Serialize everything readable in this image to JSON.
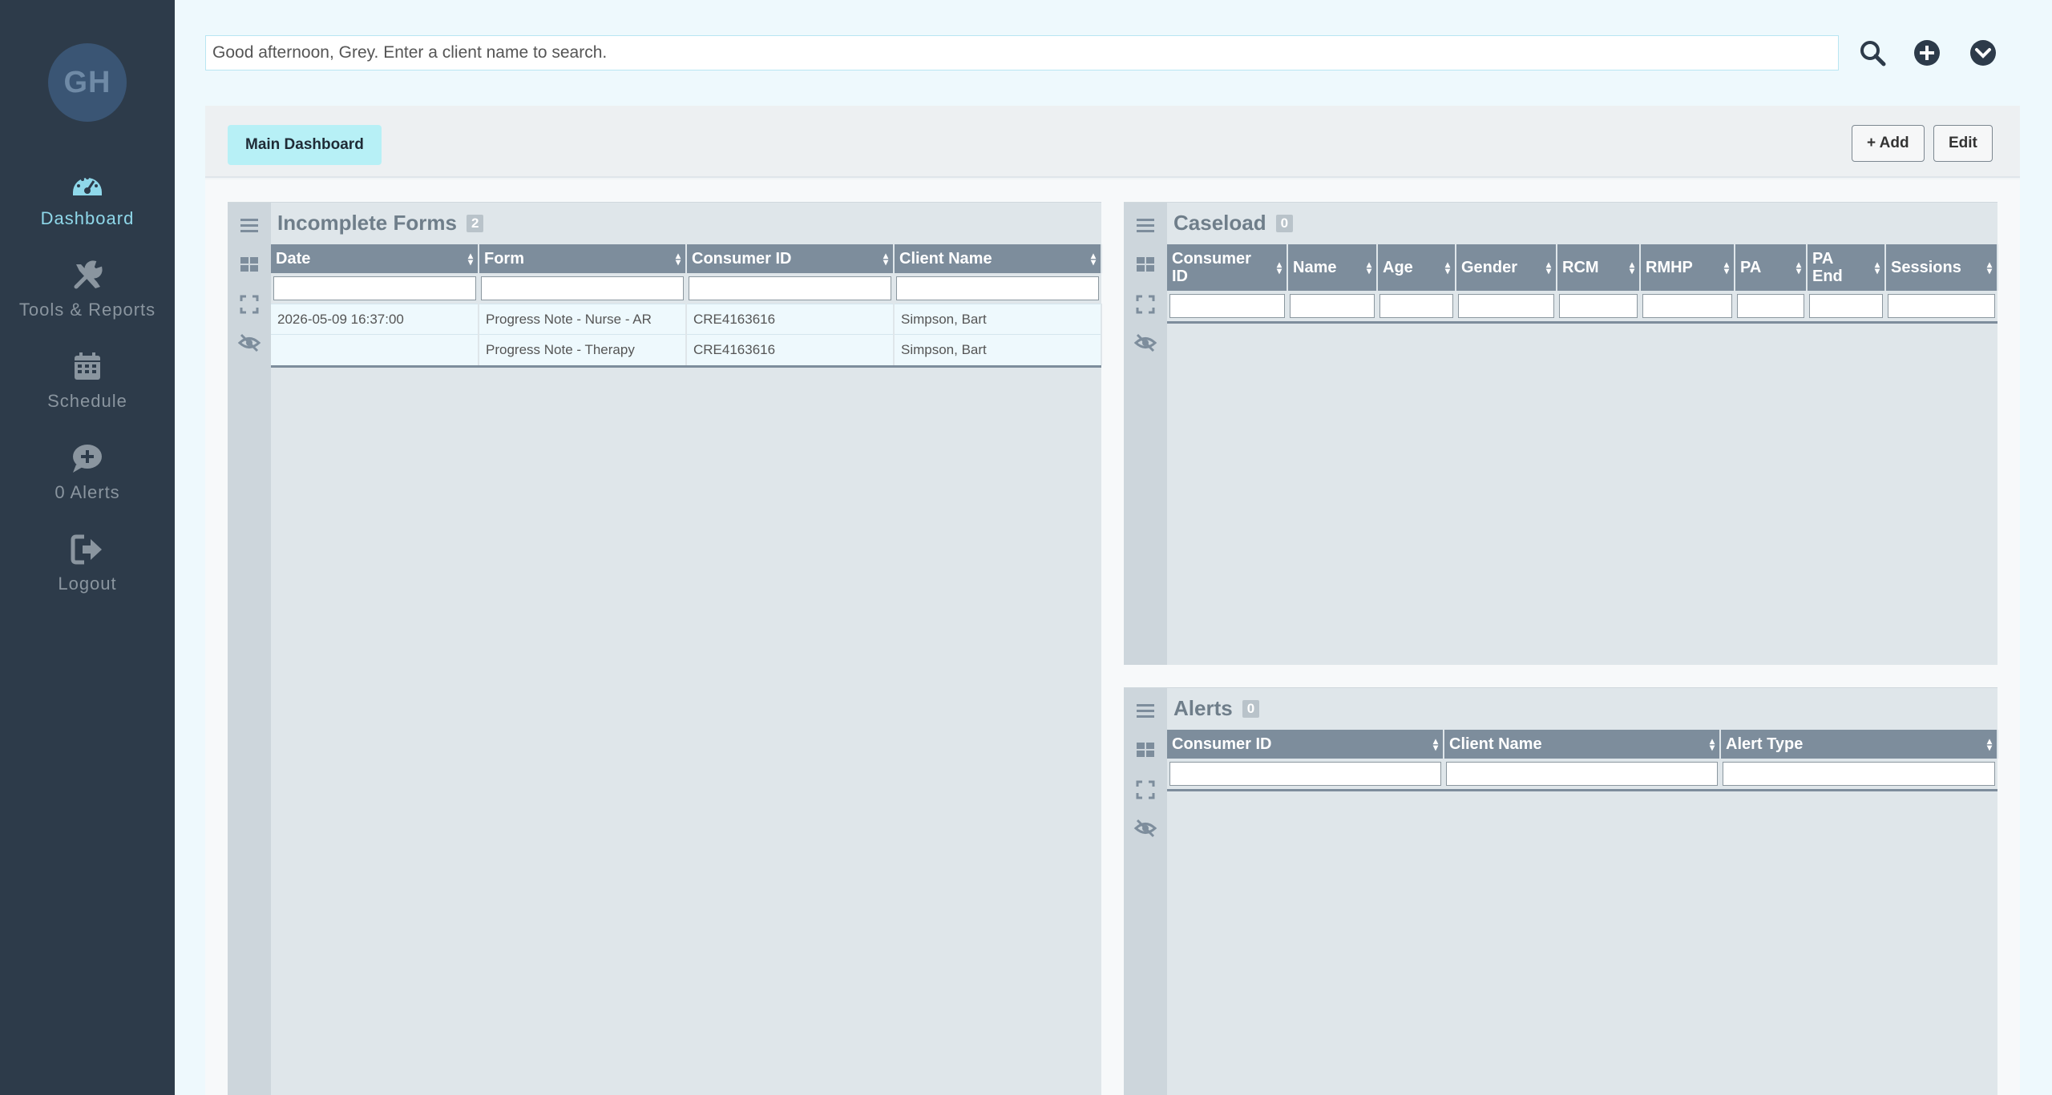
{
  "user": {
    "initials": "GH"
  },
  "nav": [
    {
      "label": "Dashboard",
      "icon": "gauge-icon"
    },
    {
      "label": "Tools & Reports",
      "icon": "tools-icon"
    },
    {
      "label": "Schedule",
      "icon": "calendar-icon"
    },
    {
      "label": "0 Alerts",
      "icon": "alert-chat-icon"
    },
    {
      "label": "Logout",
      "icon": "logout-icon"
    }
  ],
  "search": {
    "placeholder": "Good afternoon, Grey. Enter a client name to search."
  },
  "header": {
    "tab_label": "Main Dashboard",
    "add_label": "+ Add",
    "edit_label": "Edit"
  },
  "widgets": {
    "incomplete_forms": {
      "title": "Incomplete Forms",
      "count": "2",
      "columns": [
        "Date",
        "Form",
        "Consumer ID",
        "Client Name"
      ],
      "rows": [
        [
          "2026-05-09 16:37:00",
          "Progress Note - Nurse - AR",
          "CRE4163616",
          "Simpson, Bart"
        ],
        [
          "",
          "Progress Note - Therapy",
          "CRE4163616",
          "Simpson, Bart"
        ]
      ]
    },
    "caseload": {
      "title": "Caseload",
      "count": "0",
      "columns": [
        "Consumer ID",
        "Name",
        "Age",
        "Gender",
        "RCM",
        "RMHP",
        "PA",
        "PA End",
        "Sessions"
      ]
    },
    "alerts": {
      "title": "Alerts",
      "count": "0",
      "columns": [
        "Consumer ID",
        "Client Name",
        "Alert Type"
      ]
    }
  },
  "colors": {
    "sidebar": "#2d3b4a",
    "accent": "#8fd8ea",
    "table_header": "#7d8d9c",
    "tab": "#b7f0f6"
  }
}
